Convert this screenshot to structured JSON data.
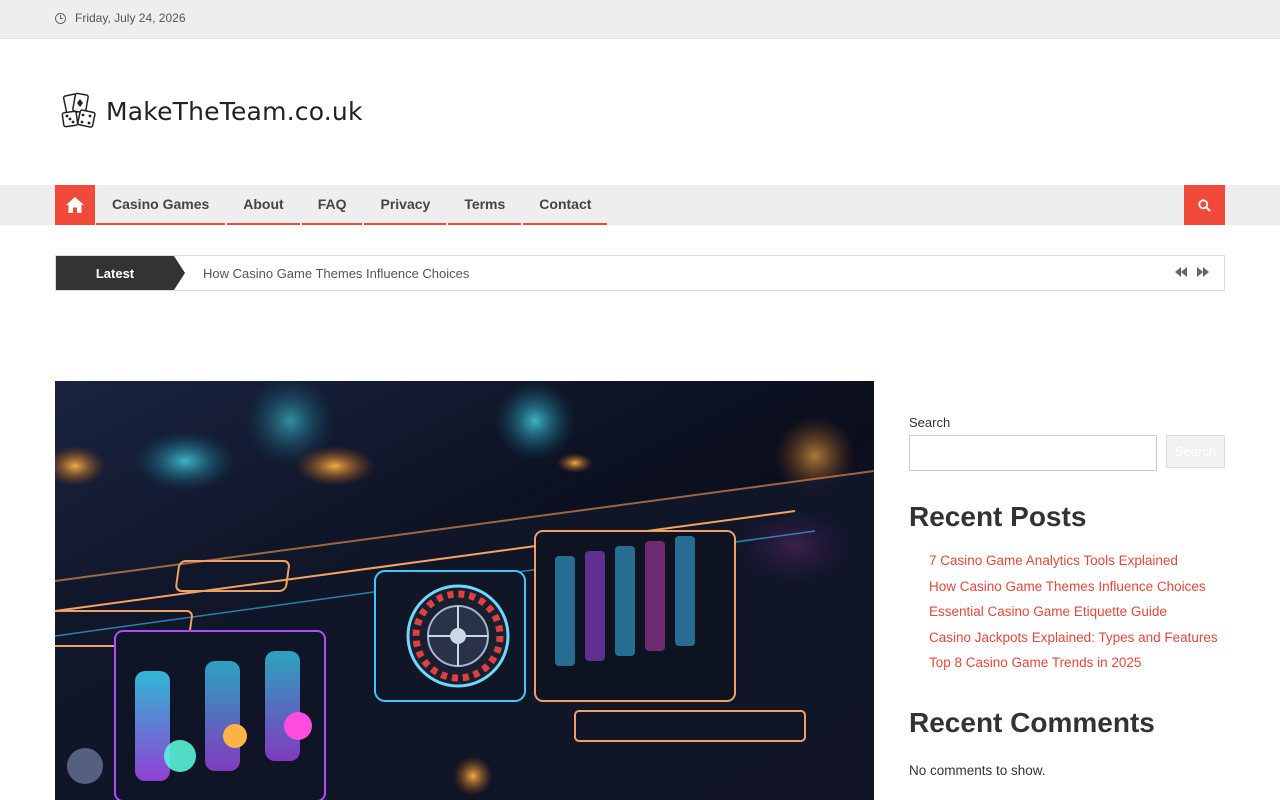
{
  "topbar": {
    "date": "Friday, July 24, 2026",
    "icon": "clock-icon"
  },
  "site": {
    "logo_text": "MakeTheTeam.co.uk",
    "logo_icon": "cards-dice-icon"
  },
  "nav": {
    "home_icon": "home-icon",
    "items": [
      {
        "label": "Casino Games"
      },
      {
        "label": "About"
      },
      {
        "label": "FAQ"
      },
      {
        "label": "Privacy"
      },
      {
        "label": "Terms"
      },
      {
        "label": "Contact"
      }
    ],
    "search_icon": "search-icon"
  },
  "ticker": {
    "label": "Latest",
    "headline": "How Casino Game Themes Influence Choices",
    "prev_icon": "rewind-icon",
    "next_icon": "fast-forward-icon"
  },
  "featured_image": {
    "subject": "futuristic casino game interface with roulette wheel"
  },
  "sidebar": {
    "search": {
      "label": "Search",
      "input_value": "",
      "button_label": "Search"
    },
    "recent_posts": {
      "title": "Recent Posts",
      "items": [
        "7 Casino Game Analytics Tools Explained",
        "How Casino Game Themes Influence Choices",
        "Essential Casino Game Etiquette Guide",
        "Casino Jackpots Explained: Types and Features",
        "Top 8 Casino Game Trends in 2025"
      ]
    },
    "recent_comments": {
      "title": "Recent Comments",
      "empty_text": "No comments to show."
    }
  },
  "colors": {
    "accent": "#ef4a3a",
    "link": "#e2483a",
    "topbar_bg": "#eeeeee",
    "ticker_label_bg": "#333333"
  }
}
